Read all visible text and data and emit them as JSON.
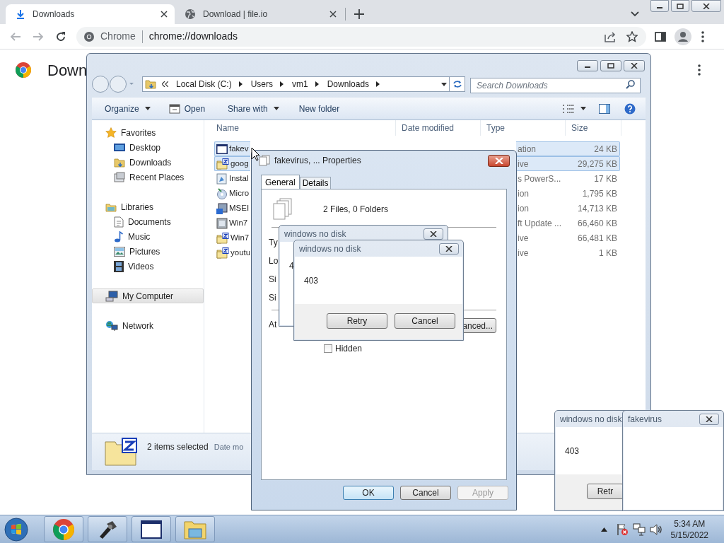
{
  "browser": {
    "tabs": [
      {
        "title": "Downloads",
        "selected": true
      },
      {
        "title": "Download | file.io",
        "selected": false
      }
    ],
    "site_label": "Chrome",
    "url": "chrome://downloads",
    "page_title": "Down"
  },
  "explorer": {
    "breadcrumb": [
      "Local Disk (C:)",
      "Users",
      "vm1",
      "Downloads"
    ],
    "search_placeholder": "Search Downloads",
    "toolbar": [
      {
        "label": "Organize",
        "kind": "menu"
      },
      {
        "label": "Open",
        "kind": "icon"
      },
      {
        "label": "Share with",
        "kind": "menu"
      },
      {
        "label": "New folder",
        "kind": "plain"
      }
    ],
    "columns": [
      "Name",
      "Date modified",
      "Type",
      "Size"
    ],
    "sidebar": [
      {
        "label": "Favorites",
        "selected": false,
        "children": [
          {
            "label": "Desktop",
            "selected": false
          },
          {
            "label": "Downloads",
            "selected": false
          },
          {
            "label": "Recent Places",
            "selected": false
          }
        ]
      },
      {
        "label": "Libraries",
        "selected": false,
        "children": [
          {
            "label": "Documents",
            "selected": false
          },
          {
            "label": "Music",
            "selected": false
          },
          {
            "label": "Pictures",
            "selected": false
          },
          {
            "label": "Videos",
            "selected": false
          }
        ]
      },
      {
        "label": "My Computer",
        "selected": true
      },
      {
        "label": "Network",
        "selected": false
      }
    ],
    "rows": [
      {
        "name": "fakev",
        "type": "ation",
        "size": "24 KB",
        "selected": true
      },
      {
        "name": "goog",
        "type": "ive",
        "size": "29,275 KB",
        "selected": true
      },
      {
        "name": "Instal",
        "type": "s PowerS...",
        "size": "17 KB",
        "selected": false
      },
      {
        "name": "Micro",
        "type": "ion",
        "size": "1,795 KB",
        "selected": false
      },
      {
        "name": "MSEI",
        "type": "ion",
        "size": "14,713 KB",
        "selected": false
      },
      {
        "name": "Win7",
        "type": "ft Update ...",
        "size": "66,460 KB",
        "selected": false
      },
      {
        "name": "Win7",
        "type": "ive",
        "size": "66,481 KB",
        "selected": false
      },
      {
        "name": "youtu",
        "type": "ive",
        "size": "1 KB",
        "selected": false
      }
    ],
    "status": {
      "count": "2 items selected",
      "detail": "Date mo"
    }
  },
  "properties": {
    "title": "fakevirus, ... Properties",
    "tabs": [
      {
        "label": "General",
        "selected": true
      },
      {
        "label": "Details",
        "selected": false
      }
    ],
    "summary": "2 Files, 0 Folders",
    "labels": [
      "Ty",
      "Lo",
      "Si",
      "Si",
      "At"
    ],
    "advanced_button": "anced...",
    "hidden_checkbox": {
      "label": "Hidden",
      "checked": false
    },
    "buttons": [
      {
        "label": "OK",
        "disabled": false
      },
      {
        "label": "Cancel",
        "disabled": false
      },
      {
        "label": "Apply",
        "disabled": true
      }
    ]
  },
  "dialogs": [
    {
      "title": "windows no disk",
      "message": "4"
    },
    {
      "title": "windows no disk",
      "message": "403",
      "buttons": [
        "Retry",
        "Cancel"
      ]
    },
    {
      "title": "windows no disk",
      "message": "403",
      "buttons": [
        "Retr"
      ]
    },
    {
      "title": "fakevirus"
    }
  ],
  "taskbar": {
    "time": "5:34 AM",
    "date": "5/15/2022"
  }
}
